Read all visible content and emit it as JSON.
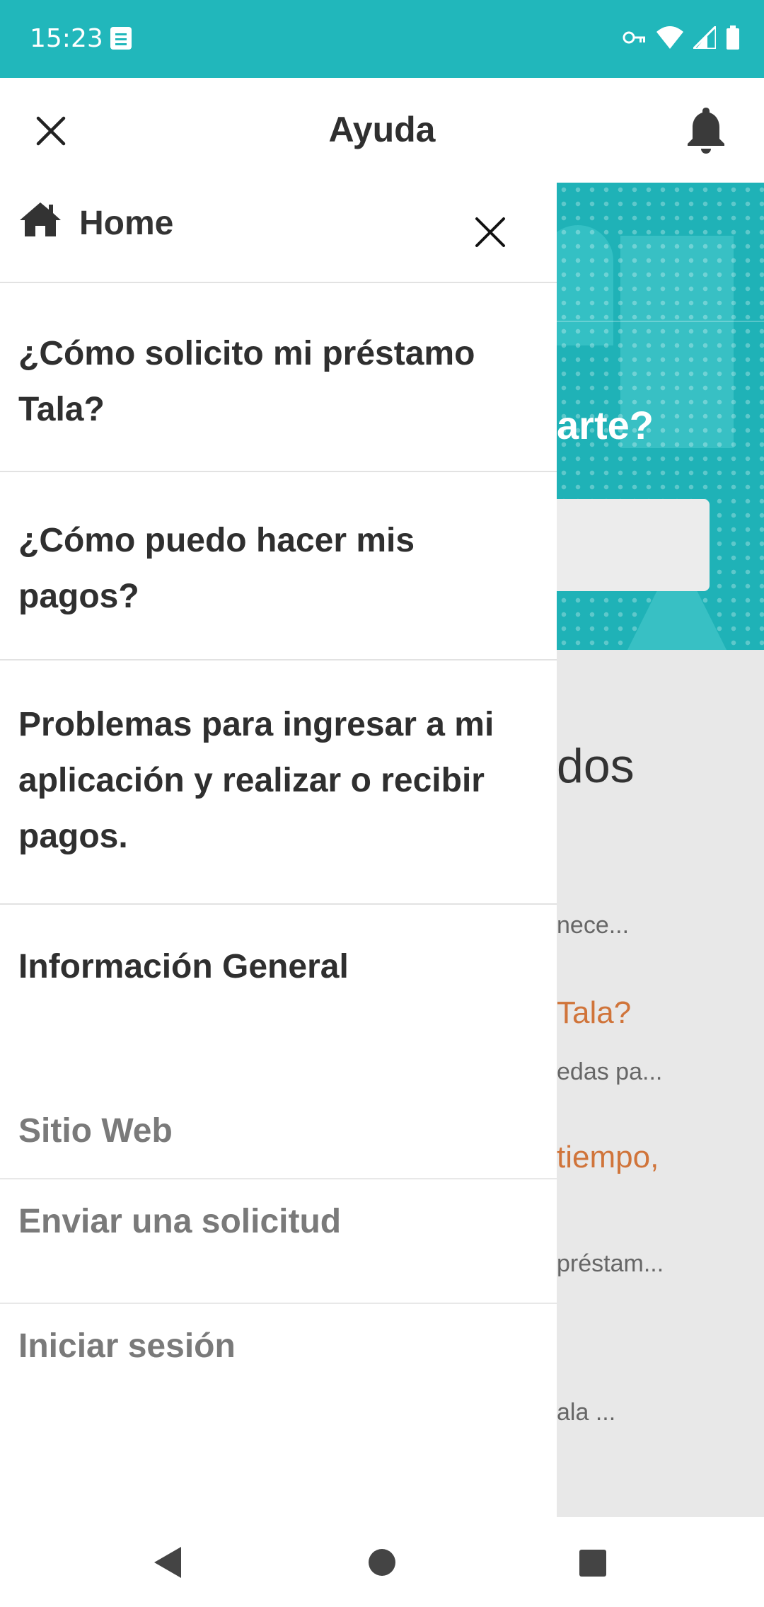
{
  "status_bar": {
    "time": "15:23",
    "icons": [
      "notification-note-icon",
      "vpn-key-icon",
      "wifi-icon",
      "signal-icon",
      "battery-icon"
    ]
  },
  "app_bar": {
    "title": "Ayuda",
    "close_icon": "close-icon",
    "bell_icon": "bell-icon"
  },
  "background": {
    "hero_text": "arte?",
    "heading": "dos",
    "lines": [
      {
        "text": "nece...",
        "style": "sub"
      },
      {
        "text": "Tala?",
        "style": "link"
      },
      {
        "text": "edas pa...",
        "style": "sub"
      },
      {
        "text": "tiempo,",
        "style": "link"
      },
      {
        "text": "préstam...",
        "style": "sub"
      },
      {
        "text": "ala ...",
        "style": "sub"
      }
    ]
  },
  "drawer": {
    "home_label": "Home",
    "items": [
      {
        "label": "¿Cómo solicito mi préstamo Tala?"
      },
      {
        "label": "¿Cómo puedo hacer mis pagos?"
      },
      {
        "label": "Problemas para ingresar a mi aplicación y realizar o recibir pagos."
      },
      {
        "label": "Información General"
      }
    ],
    "secondary": [
      {
        "label": "Sitio Web"
      },
      {
        "label": "Enviar una solicitud"
      },
      {
        "label": "Iniciar sesión"
      }
    ]
  },
  "colors": {
    "teal": "#21b7bb",
    "link_orange": "#d0743a",
    "text_dark": "#2f2f2f",
    "text_gray": "#7a7a7a"
  }
}
